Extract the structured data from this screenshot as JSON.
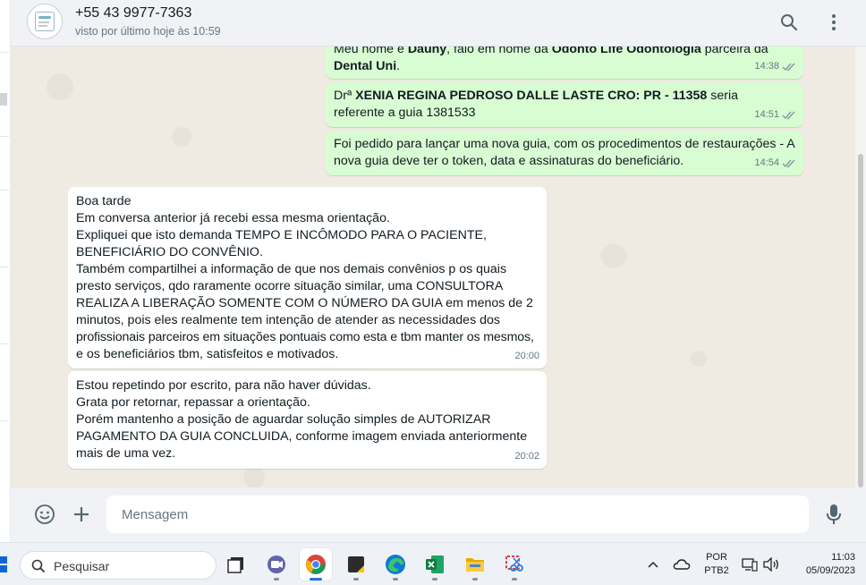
{
  "header": {
    "contact_name": "+55 43 9977-7363",
    "last_seen": "visto por último hoje às 10:59",
    "search_icon": "search-icon",
    "menu_icon": "kebab-menu-icon"
  },
  "messages": [
    {
      "direction": "out",
      "parts": [
        {
          "text": "Meu nome é ",
          "bold": false
        },
        {
          "text": "Dauny",
          "bold": true
        },
        {
          "text": ", falo em nome da ",
          "bold": false
        },
        {
          "text": "Odonto Life Odontologia",
          "bold": true
        },
        {
          "text": " parceira da ",
          "bold": false
        },
        {
          "text": "Dental Uni",
          "bold": true
        },
        {
          "text": ".",
          "bold": false
        }
      ],
      "time": "14:38",
      "status": "read"
    },
    {
      "direction": "out",
      "parts": [
        {
          "text": "Drª ",
          "bold": false
        },
        {
          "text": "XENIA REGINA PEDROSO DALLE LASTE CRO: PR - 11358",
          "bold": true
        },
        {
          "text": " seria referente a guia 1381533",
          "bold": false
        }
      ],
      "time": "14:51",
      "status": "read"
    },
    {
      "direction": "out",
      "parts": [
        {
          "text": "Foi pedido para lançar uma nova guia, com os procedimentos de restaurações - A nova guia deve ter o token, data e assinaturas do beneficiário.",
          "bold": false
        }
      ],
      "time": "14:54",
      "status": "read"
    },
    {
      "direction": "in",
      "lines": [
        "Boa tarde",
        "Em conversa anterior já recebi essa mesma orientação.",
        "Expliquei que isto demanda TEMPO E INCÔMODO PARA O PACIENTE,",
        "BENEFICIÁRIO DO CONVÊNIO.",
        "Também compartilhei a informação de que nos demais convênios p os quais",
        "presto serviços, qdo raramente ocorre situação similar, uma CONSULTORA",
        "REALIZA A LIBERAÇÃO SOMENTE COM O NÚMERO DA GUIA em menos de 2",
        "minutos, pois eles realmente tem intenção de atender as necessidades dos",
        "profissionais parceiros em situações pontuais como esta e tbm manter os mesmos,",
        "e os beneficiários tbm, satisfeitos e motivados."
      ],
      "time": "20:00"
    },
    {
      "direction": "in",
      "lines": [
        "Estou repetindo por escrito, para não haver dúvidas.",
        "Grata por retornar, repassar a orientação.",
        "Porém mantenho a posição de aguardar solução simples de AUTORIZAR",
        "PAGAMENTO DA GUIA CONCLUIDA, conforme imagem enviada anteriormente",
        "mais de uma vez."
      ],
      "time": "20:02"
    }
  ],
  "composer": {
    "placeholder": "Mensagem",
    "emoji_icon": "emoji-icon",
    "attach_icon": "plus-icon",
    "mic_icon": "microphone-icon"
  },
  "taskbar": {
    "search_label": "Pesquisar",
    "apps": [
      "task-view-icon",
      "video-call-app-icon",
      "chrome-icon",
      "sticky-app-icon",
      "edge-icon",
      "excel-icon",
      "file-explorer-icon",
      "snipping-tool-icon"
    ],
    "active_app": "chrome-icon",
    "lang_line1": "POR",
    "lang_line2": "PTB2",
    "time": "11:03",
    "date": "05/09/2023"
  },
  "colors": {
    "outgoing_bubble": "#d9fdd3",
    "incoming_bubble": "#ffffff",
    "chat_background": "#efeae2",
    "read_ticks": "#8696a0"
  }
}
